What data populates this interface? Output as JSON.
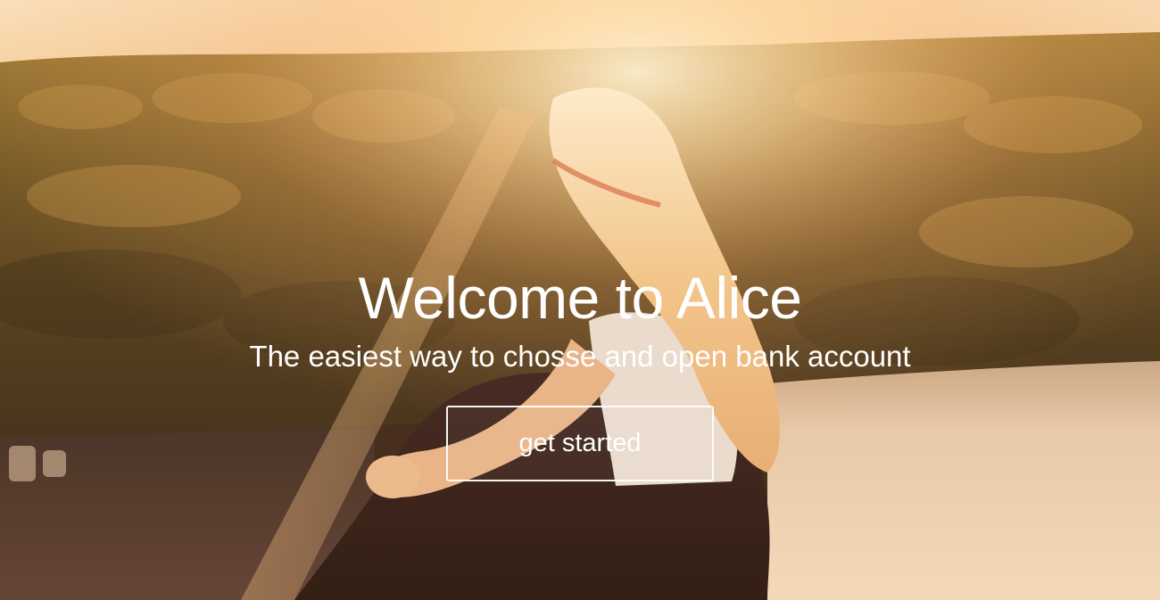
{
  "hero": {
    "title": "Welcome to Alice",
    "subtitle": "The easiest way to chosse and open bank account",
    "cta_label": "get started"
  },
  "colors": {
    "text": "#ffffff",
    "sky_glow": "#fbe3bf",
    "forest": "#4a3a16",
    "lake_light": "#f4d9b8"
  }
}
